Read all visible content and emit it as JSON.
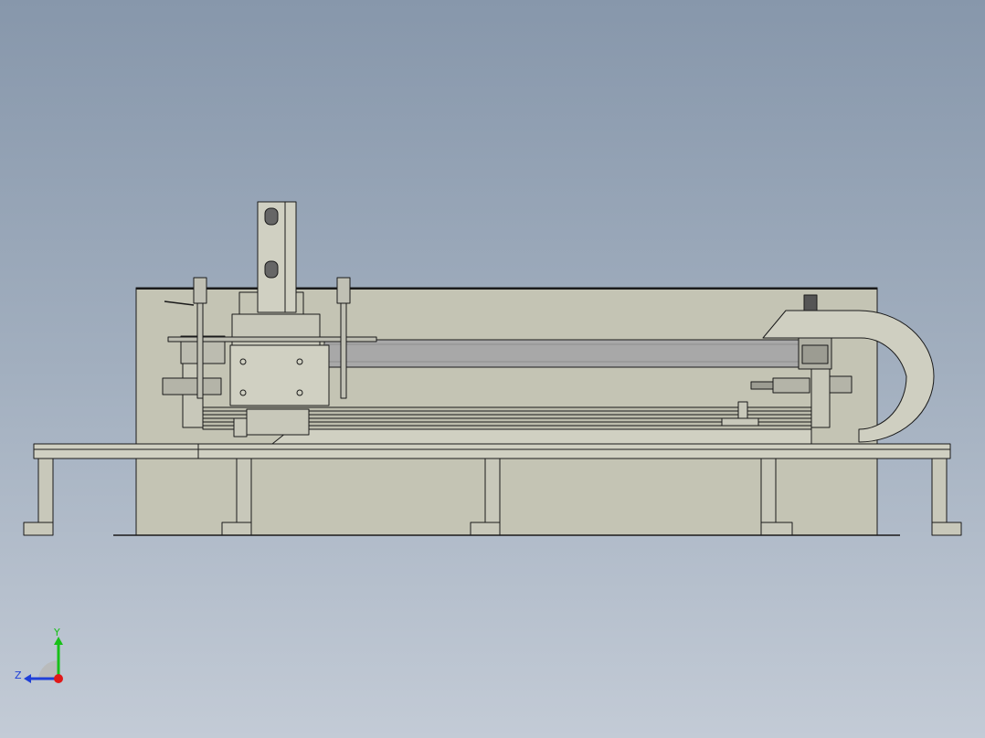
{
  "viewport": {
    "background_top": "#8797ab",
    "background_bottom": "#c3cbd6"
  },
  "model": {
    "body_color": "#c4c4b4",
    "shaded_color": "#d6d6c8",
    "edge_color": "#1a1a1a",
    "rod_color": "#a8a8a8"
  },
  "triad": {
    "y_label": "Y",
    "z_label": "Z",
    "y_color": "#18c018",
    "z_color": "#1f3fd8",
    "x_color": "#e01818",
    "y_icon": "y-axis-arrow",
    "z_icon": "z-axis-arrow",
    "x_icon": "x-axis-dot"
  }
}
